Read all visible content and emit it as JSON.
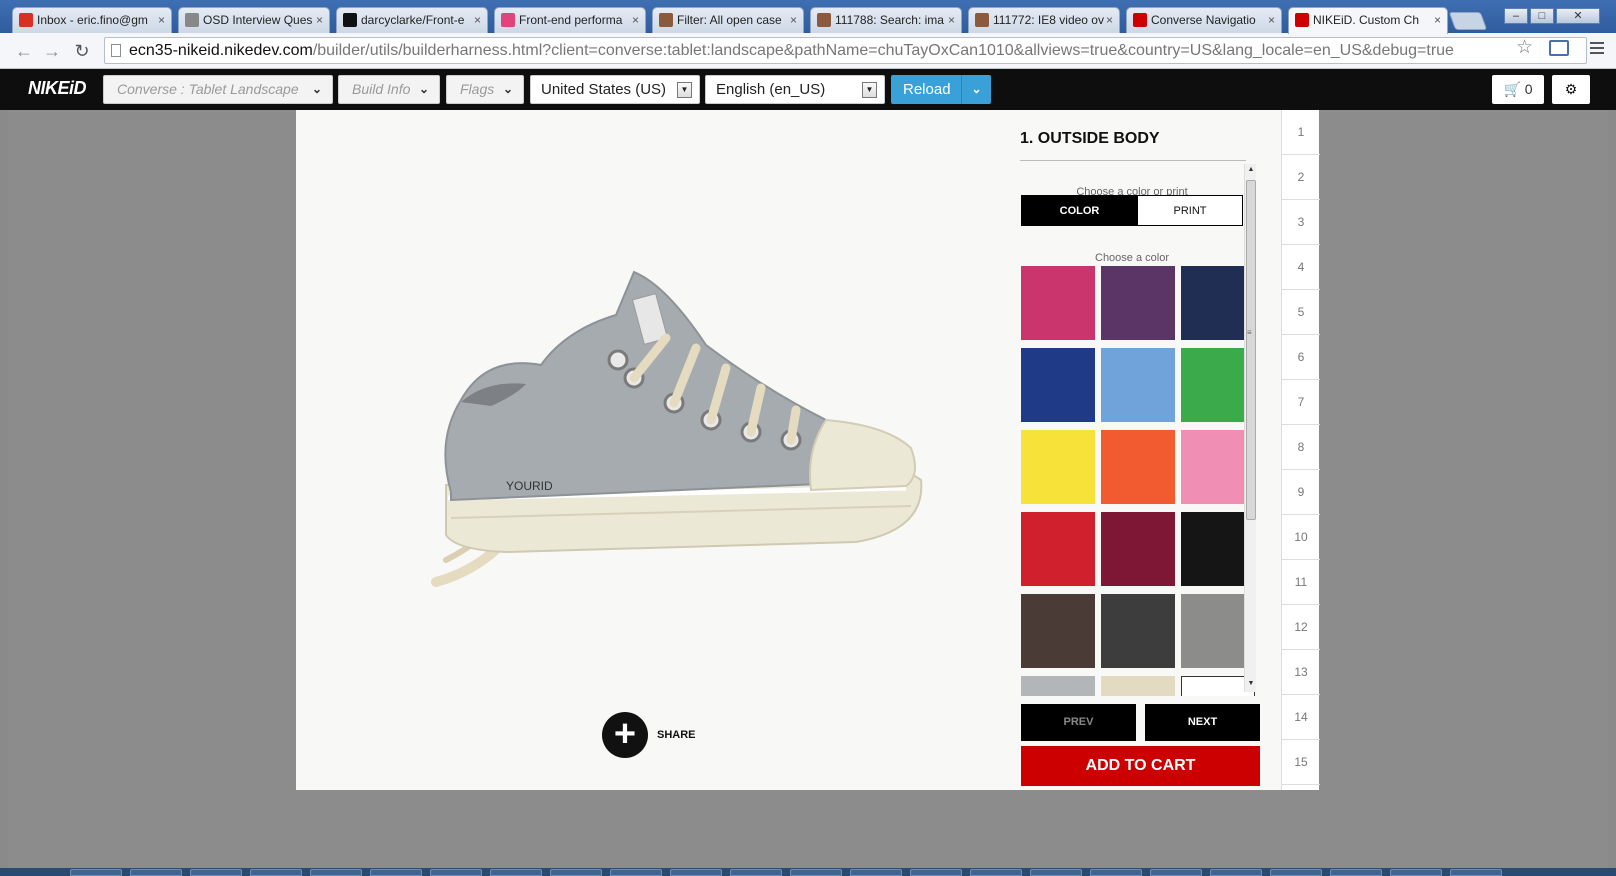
{
  "browser": {
    "tabs": [
      {
        "title": "Inbox - eric.fino@gm",
        "icon": "gmail-icon",
        "icon_color": "#d93025"
      },
      {
        "title": "OSD Interview Ques",
        "icon": "document-icon",
        "icon_color": "#888888"
      },
      {
        "title": "darcyclarke/Front-e",
        "icon": "github-icon",
        "icon_color": "#111111"
      },
      {
        "title": "Front-end performa",
        "icon": "css-icon",
        "icon_color": "#e0447a"
      },
      {
        "title": "Filter: All open case",
        "icon": "fogbugz-icon",
        "icon_color": "#8b5a3c"
      },
      {
        "title": "111788: Search: ima",
        "icon": "fogbugz-icon",
        "icon_color": "#8b5a3c"
      },
      {
        "title": "111772: IE8 video ov",
        "icon": "fogbugz-icon",
        "icon_color": "#8b5a3c"
      },
      {
        "title": "Converse Navigatio",
        "icon": "nike-icon",
        "icon_color": "#cc0000"
      },
      {
        "title": "NIKEiD. Custom Ch",
        "icon": "nike-icon",
        "icon_color": "#cc0000"
      }
    ],
    "url_host": "ecn35-nikeid.nikedev.com",
    "url_rest": "/builder/utils/builderharness.html?client=converse:tablet:landscape&pathName=chuTayOxCan1010&allviews=true&country=US&lang_locale=en_US&debug=true"
  },
  "header": {
    "logo": "NIKEiD",
    "client_select": "Converse : Tablet Landscape",
    "build_info": "Build Info",
    "flags": "Flags",
    "country": "United States (US)",
    "language": "English (en_US)",
    "reload": "Reload",
    "cart_count": "0"
  },
  "preview": {
    "personalization": "YOURID",
    "share_label": "SHARE"
  },
  "panel": {
    "title": "1. OUTSIDE BODY",
    "choose_color_or_print": "Choose a color or print",
    "toggle_color": "COLOR",
    "toggle_print": "PRINT",
    "choose_color": "Choose a color",
    "swatches": [
      "#c9356c",
      "#5b3566",
      "#1f2e52",
      "#1f3a86",
      "#6fa3d9",
      "#3aaa4b",
      "#f7e23a",
      "#f15b2f",
      "#f08eb3",
      "#d0202e",
      "#7d1735",
      "#151515",
      "#4b3b37",
      "#3d3d3d",
      "#8c8c8b",
      "#b3b6b8",
      "#e3dbc1",
      "#ffffff"
    ],
    "prev": "PREV",
    "next": "NEXT",
    "add_to_cart": "ADD TO CART"
  },
  "steps": [
    "1",
    "2",
    "3",
    "4",
    "5",
    "6",
    "7",
    "8",
    "9",
    "10",
    "11",
    "12",
    "13",
    "14",
    "15"
  ]
}
